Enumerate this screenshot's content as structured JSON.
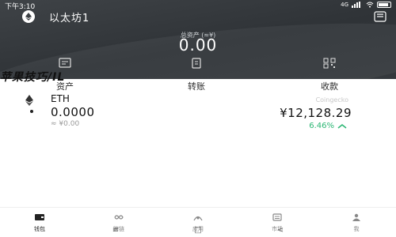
{
  "status_bar": {
    "time": "下午3:10",
    "network": "4G",
    "colors": {
      "text": "#ffffff"
    }
  },
  "header": {
    "wallet_name": "以太坊1",
    "avatar_icon": "avatar-icon",
    "scan_icon": "scan-icon"
  },
  "total": {
    "label": "总资产 (≈¥)",
    "value": "0.00"
  },
  "actions": [
    {
      "label": "资产",
      "icon": "assets-icon"
    },
    {
      "label": "转账",
      "icon": "transfer-icon"
    },
    {
      "label": "收款",
      "icon": "receive-icon"
    }
  ],
  "overlay_text": "苹果技巧/IL",
  "asset": {
    "symbol": "ETH",
    "amount": "0.0000",
    "fiat": "≈ ¥0.00",
    "price_source": "Coingecko",
    "price": "¥12,128.29",
    "change": "6.46%",
    "change_color": "#2bb673"
  },
  "bottom_nav": [
    {
      "label": "钱包",
      "icon": "wallet-icon",
      "active": true
    },
    {
      "label": "跨链",
      "icon": "cross-chain-icon",
      "active": false
    },
    {
      "label": "应用",
      "icon": "apps-icon",
      "active": false
    },
    {
      "label": "市场",
      "icon": "market-icon",
      "active": false
    },
    {
      "label": "我",
      "icon": "profile-icon",
      "active": false
    }
  ],
  "system_nav": {
    "menu": "≡",
    "home": "□",
    "back": "<"
  }
}
